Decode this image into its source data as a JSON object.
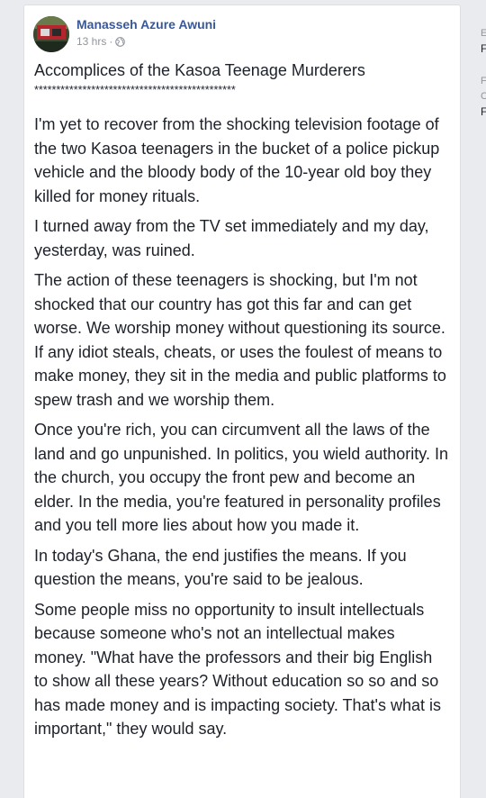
{
  "post": {
    "author": "Manasseh Azure Awuni",
    "time": "13 hrs",
    "dot": "·",
    "privacy_icon": "globe-icon",
    "title": "Accomplices of the Kasoa Teenage Murderers",
    "divider": "**********************************************",
    "paragraphs": [
      "I'm yet to recover from the shocking television footage of the two Kasoa teenagers in the bucket of a police pickup vehicle and the bloody body of the 10-year old boy they killed for money rituals.",
      "I turned away from the TV set immediately and my day, yesterday, was ruined.",
      "The action of these teenagers is shocking, but I'm not shocked that our country has got this far and can get worse. We worship money without questioning its source. If any idiot steals, cheats, or uses the foulest of means to make money, they sit in the media and public platforms to spew trash and we worship them.",
      "Once you're rich, you can circumvent all the laws of the land and go unpunished. In politics, you wield authority. In the church, you occupy the front pew and become an elder. In the media, you're featured in personality profiles and you tell more lies about how you made it.",
      "In today's Ghana, the end justifies the means. If you question the means, you're said to be jealous.",
      "Some people miss no opportunity to insult intellectuals because someone who's not an intellectual makes money. \"What have the professors and their big English to show all these years? Without education so so and so has made money and is impacting society. That's what is important,\" they would say."
    ]
  },
  "right_rail": {
    "lines": [
      "E",
      "F",
      "F",
      "C",
      "F"
    ]
  },
  "colors": {
    "link": "#385898",
    "text": "#1d2129",
    "meta": "#90949c",
    "background": "#e9ebee"
  }
}
